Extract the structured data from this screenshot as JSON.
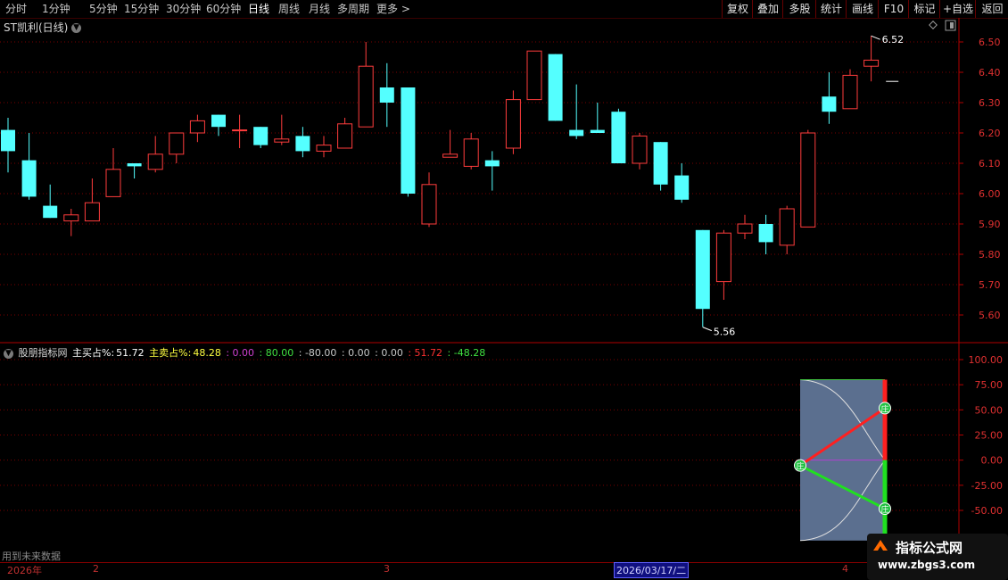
{
  "toolbar": {
    "periods": [
      "分时",
      "1分钟",
      "5分钟",
      "15分钟",
      "30分钟",
      "60分钟",
      "日线",
      "周线",
      "月线",
      "多周期",
      "更多"
    ],
    "active_period": "日线",
    "right_buttons": [
      "复权",
      "叠加",
      "多股",
      "统计",
      "画线",
      "F10",
      "标记",
      "+自选",
      "返回"
    ]
  },
  "stock": {
    "title": "ST凯利(日线)"
  },
  "price_axis": {
    "ticks": [
      "6.50",
      "6.40",
      "6.30",
      "6.20",
      "6.10",
      "6.00",
      "5.90",
      "5.80",
      "5.70",
      "5.60"
    ],
    "max_label": "6.52",
    "min_label": "5.56"
  },
  "candles": [
    {
      "o": 6.21,
      "h": 6.25,
      "l": 6.07,
      "c": 6.14
    },
    {
      "o": 6.11,
      "h": 6.2,
      "l": 5.98,
      "c": 5.99
    },
    {
      "o": 5.96,
      "h": 6.03,
      "l": 5.92,
      "c": 5.92
    },
    {
      "o": 5.91,
      "h": 5.95,
      "l": 5.86,
      "c": 5.93
    },
    {
      "o": 5.91,
      "h": 6.05,
      "l": 5.91,
      "c": 5.97
    },
    {
      "o": 5.99,
      "h": 6.15,
      "l": 5.99,
      "c": 6.08
    },
    {
      "o": 6.1,
      "h": 6.1,
      "l": 6.05,
      "c": 6.09
    },
    {
      "o": 6.08,
      "h": 6.19,
      "l": 6.07,
      "c": 6.13
    },
    {
      "o": 6.13,
      "h": 6.2,
      "l": 6.1,
      "c": 6.2
    },
    {
      "o": 6.2,
      "h": 6.26,
      "l": 6.17,
      "c": 6.24
    },
    {
      "o": 6.26,
      "h": 6.26,
      "l": 6.19,
      "c": 6.22
    },
    {
      "o": 6.21,
      "h": 6.26,
      "l": 6.15,
      "c": 6.21
    },
    {
      "o": 6.22,
      "h": 6.22,
      "l": 6.15,
      "c": 6.16
    },
    {
      "o": 6.17,
      "h": 6.26,
      "l": 6.16,
      "c": 6.18
    },
    {
      "o": 6.19,
      "h": 6.22,
      "l": 6.12,
      "c": 6.14
    },
    {
      "o": 6.14,
      "h": 6.19,
      "l": 6.12,
      "c": 6.16
    },
    {
      "o": 6.15,
      "h": 6.25,
      "l": 6.15,
      "c": 6.23
    },
    {
      "o": 6.22,
      "h": 6.5,
      "l": 6.22,
      "c": 6.42
    },
    {
      "o": 6.35,
      "h": 6.43,
      "l": 6.22,
      "c": 6.3
    },
    {
      "o": 6.35,
      "h": 6.35,
      "l": 5.99,
      "c": 6.0
    },
    {
      "o": 5.9,
      "h": 6.07,
      "l": 5.89,
      "c": 6.03
    },
    {
      "o": 6.12,
      "h": 6.21,
      "l": 6.12,
      "c": 6.13
    },
    {
      "o": 6.09,
      "h": 6.2,
      "l": 6.08,
      "c": 6.18
    },
    {
      "o": 6.11,
      "h": 6.14,
      "l": 6.01,
      "c": 6.09
    },
    {
      "o": 6.15,
      "h": 6.34,
      "l": 6.13,
      "c": 6.31
    },
    {
      "o": 6.31,
      "h": 6.47,
      "l": 6.31,
      "c": 6.47
    },
    {
      "o": 6.46,
      "h": 6.46,
      "l": 6.24,
      "c": 6.24
    },
    {
      "o": 6.21,
      "h": 6.36,
      "l": 6.18,
      "c": 6.19
    },
    {
      "o": 6.21,
      "h": 6.3,
      "l": 6.2,
      "c": 6.2
    },
    {
      "o": 6.27,
      "h": 6.28,
      "l": 6.1,
      "c": 6.1
    },
    {
      "o": 6.1,
      "h": 6.2,
      "l": 6.08,
      "c": 6.19
    },
    {
      "o": 6.17,
      "h": 6.17,
      "l": 6.01,
      "c": 6.03
    },
    {
      "o": 6.06,
      "h": 6.1,
      "l": 5.97,
      "c": 5.98
    },
    {
      "o": 5.88,
      "h": 5.88,
      "l": 5.56,
      "c": 5.62
    },
    {
      "o": 5.71,
      "h": 5.88,
      "l": 5.65,
      "c": 5.87
    },
    {
      "o": 5.87,
      "h": 5.93,
      "l": 5.85,
      "c": 5.9
    },
    {
      "o": 5.9,
      "h": 5.93,
      "l": 5.8,
      "c": 5.84
    },
    {
      "o": 5.83,
      "h": 5.96,
      "l": 5.8,
      "c": 5.95
    },
    {
      "o": 5.89,
      "h": 6.21,
      "l": 5.89,
      "c": 6.2
    },
    {
      "o": 6.32,
      "h": 6.4,
      "l": 6.23,
      "c": 6.27
    },
    {
      "o": 6.28,
      "h": 6.41,
      "l": 6.28,
      "c": 6.39
    },
    {
      "o": 6.42,
      "h": 6.52,
      "l": 6.37,
      "c": 6.44
    },
    {
      "o": 6.37,
      "h": 6.37,
      "l": 6.37,
      "c": 6.37
    }
  ],
  "indicator": {
    "name": "股朋指标网",
    "buy_label": "主买占%:",
    "buy_value": "51.72",
    "sell_label": "主卖占%:",
    "sell_value": "48.28",
    "extra_values": [
      ": 0.00",
      ": 80.00",
      ": -80.00",
      ": 0.00",
      ": 0.00",
      ": 51.72",
      ": -48.28"
    ],
    "extra_colors": [
      "#d040d0",
      "#40e040",
      "#c8c8c8",
      "#c8c8c8",
      "#c8c8c8",
      "#ff3030",
      "#40e040"
    ],
    "axis_ticks": [
      "100.00",
      "75.00",
      "50.00",
      "25.00",
      "0.00",
      "-25.00",
      "-50.00"
    ],
    "buy_pct": 51.72,
    "sell_pct": -48.28,
    "marker_char": "庄"
  },
  "future_notice": "用到未来数据",
  "dates": {
    "labels": [
      "2026年",
      "2",
      "3",
      "4"
    ],
    "selected": "2026/03/17/二"
  },
  "watermark": {
    "title": "指标公式网",
    "url": "www.zbgs3.com"
  },
  "colors": {
    "up": "#ff3c3c",
    "down": "#54ffff",
    "grid": "#7a0000",
    "frame": "#b00000"
  }
}
